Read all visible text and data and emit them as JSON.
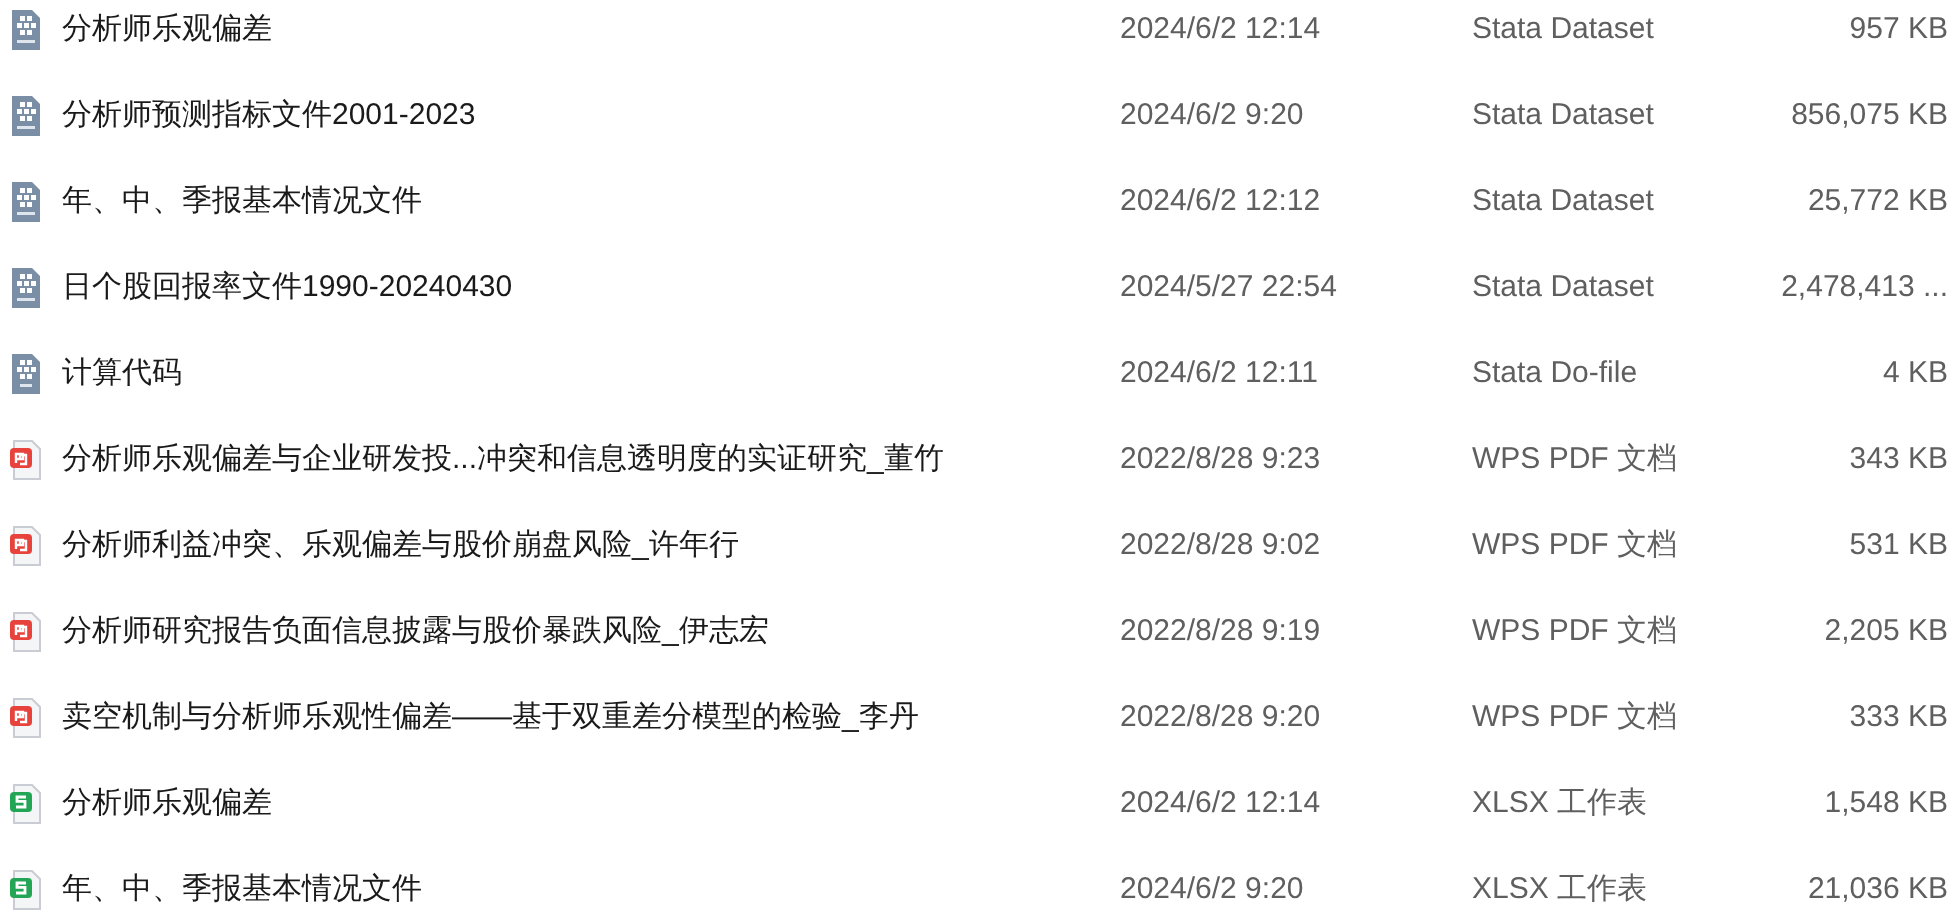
{
  "files": [
    {
      "kind": "dta",
      "name": "分析师乐观偏差",
      "modified": "2024/6/2 12:14",
      "type": "Stata Dataset",
      "size": "957 KB"
    },
    {
      "kind": "dta",
      "name": "分析师预测指标文件2001-2023",
      "modified": "2024/6/2 9:20",
      "type": "Stata Dataset",
      "size": "856,075 KB"
    },
    {
      "kind": "dta",
      "name": "年、中、季报基本情况文件",
      "modified": "2024/6/2 12:12",
      "type": "Stata Dataset",
      "size": "25,772 KB"
    },
    {
      "kind": "dta",
      "name": "日个股回报率文件1990-20240430",
      "modified": "2024/5/27 22:54",
      "type": "Stata Dataset",
      "size": "2,478,413 ..."
    },
    {
      "kind": "do",
      "name": "计算代码",
      "modified": "2024/6/2 12:11",
      "type": "Stata Do-file",
      "size": "4 KB"
    },
    {
      "kind": "pdf",
      "name": "分析师乐观偏差与企业研发投...冲突和信息透明度的实证研究_董竹",
      "modified": "2022/8/28 9:23",
      "type": "WPS PDF 文档",
      "size": "343 KB"
    },
    {
      "kind": "pdf",
      "name": "分析师利益冲突、乐观偏差与股价崩盘风险_许年行",
      "modified": "2022/8/28 9:02",
      "type": "WPS PDF 文档",
      "size": "531 KB"
    },
    {
      "kind": "pdf",
      "name": "分析师研究报告负面信息披露与股价暴跌风险_伊志宏",
      "modified": "2022/8/28 9:19",
      "type": "WPS PDF 文档",
      "size": "2,205 KB"
    },
    {
      "kind": "pdf",
      "name": "卖空机制与分析师乐观性偏差——基于双重差分模型的检验_李丹",
      "modified": "2022/8/28 9:20",
      "type": "WPS PDF 文档",
      "size": "333 KB"
    },
    {
      "kind": "xlsx",
      "name": "分析师乐观偏差",
      "modified": "2024/6/2 12:14",
      "type": "XLSX 工作表",
      "size": "1,548 KB"
    },
    {
      "kind": "xlsx",
      "name": "年、中、季报基本情况文件",
      "modified": "2024/6/2 9:20",
      "type": "XLSX 工作表",
      "size": "21,036 KB"
    }
  ]
}
